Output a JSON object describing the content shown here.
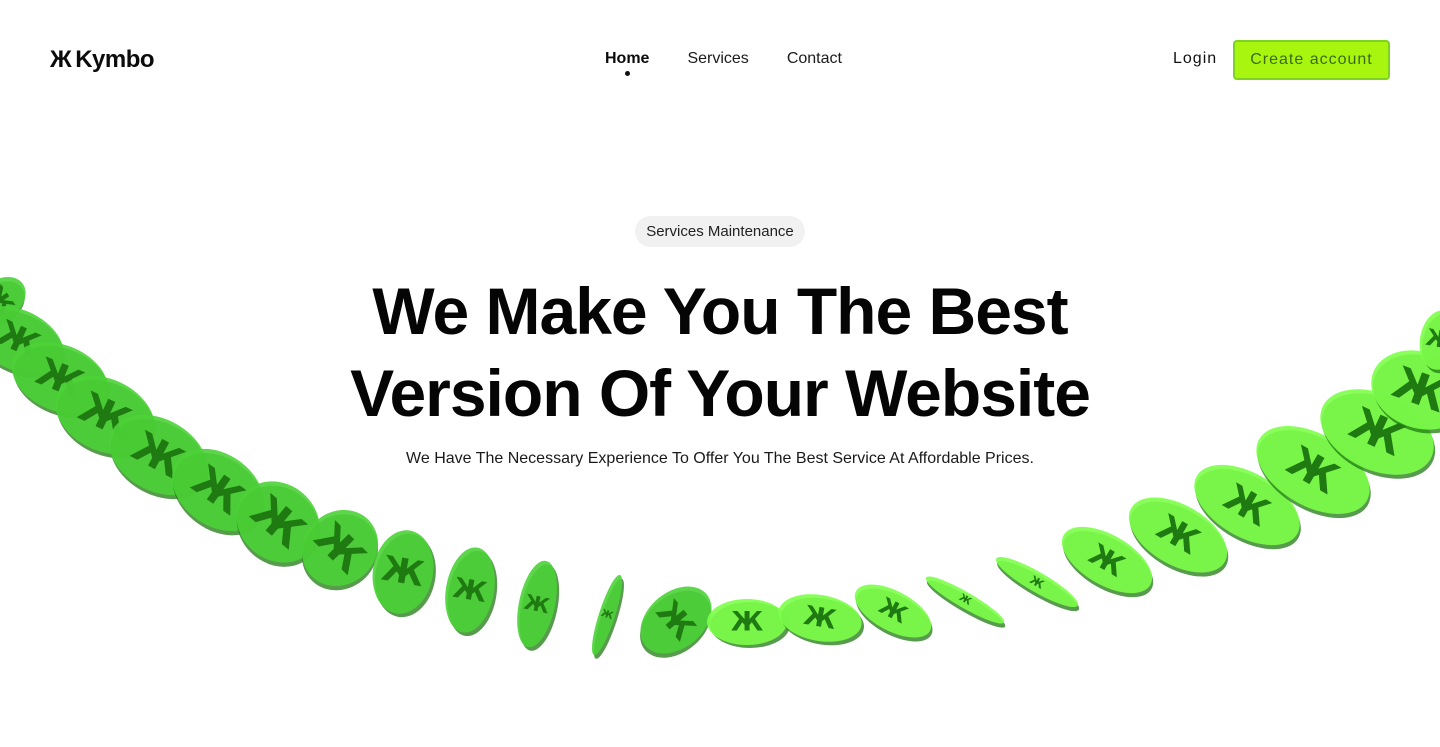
{
  "brand": {
    "logo_mark": "Ж",
    "name": "Kymbo"
  },
  "nav": {
    "items": [
      {
        "label": "Home",
        "active": true
      },
      {
        "label": "Services",
        "active": false
      },
      {
        "label": "Contact",
        "active": false
      }
    ]
  },
  "auth": {
    "login_label": "Login",
    "create_account_label": "Create account"
  },
  "hero": {
    "tag": "Services Maintenance",
    "headline_line1": "We Make You The Best",
    "headline_line2": "Version Of Your Website",
    "subtitle": "We Have The Necessary Experience To Offer You The Best Service At Affordable Prices."
  },
  "decoration": {
    "coin_symbol": "Ж",
    "coin_color": "#4cd137",
    "coin_highlight": "#7dff4a",
    "coin_shadow": "#1f7a12",
    "accent": "#a8f510"
  }
}
